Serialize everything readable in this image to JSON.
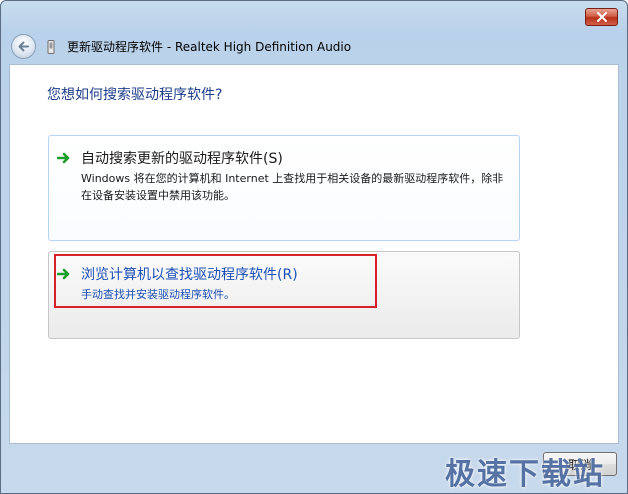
{
  "window": {
    "close_label": "✕"
  },
  "nav": {
    "title": "更新驱动程序软件 - Realtek High Definition Audio"
  },
  "content": {
    "question": "您想如何搜索驱动程序软件?",
    "options": [
      {
        "title": "自动搜索更新的驱动程序软件(S)",
        "description": "Windows 将在您的计算机和 Internet 上查找用于相关设备的最新驱动程序软件，除非在设备安装设置中禁用该功能。"
      },
      {
        "title": "浏览计算机以查找驱动程序软件(R)",
        "description": "手动查找并安装驱动程序软件。"
      }
    ]
  },
  "footer": {
    "cancel_label": "取消"
  },
  "watermark": {
    "text": "极速下载站"
  },
  "colors": {
    "link_blue": "#1b4fb5",
    "heading_blue": "#1e3e8a",
    "highlight_red": "#d52027",
    "arrow_green": "#1e9e2a"
  }
}
